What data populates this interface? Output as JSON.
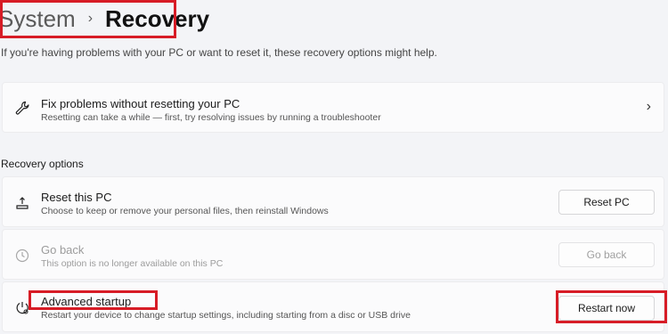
{
  "breadcrumb": {
    "root": "System",
    "separator": "›",
    "current": "Recovery"
  },
  "description": "If you're having problems with your PC or want to reset it, these recovery options might help.",
  "fix_card": {
    "title": "Fix problems without resetting your PC",
    "subtitle": "Resetting can take a while — first, try resolving issues by running a troubleshooter",
    "icon": "wrench-icon"
  },
  "section_title": "Recovery options",
  "options": [
    {
      "title": "Reset this PC",
      "subtitle": "Choose to keep or remove your personal files, then reinstall Windows",
      "button": "Reset PC",
      "icon": "reset-pc-icon",
      "enabled": true
    },
    {
      "title": "Go back",
      "subtitle": "This option is no longer available on this PC",
      "button": "Go back",
      "icon": "history-icon",
      "enabled": false
    },
    {
      "title": "Advanced startup",
      "subtitle": "Restart your device to change startup settings, including starting from a disc or USB drive",
      "button": "Restart now",
      "icon": "advanced-startup-icon",
      "enabled": true
    }
  ],
  "highlight_color": "#d71c26"
}
